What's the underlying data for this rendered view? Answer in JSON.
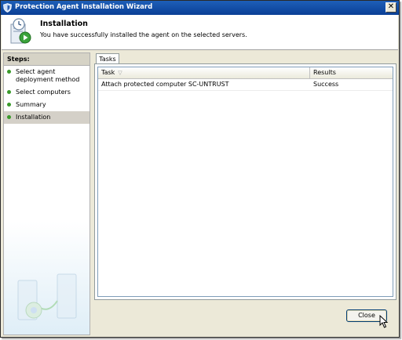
{
  "window": {
    "title": "Protection Agent Installation Wizard",
    "close_glyph": "✕"
  },
  "header": {
    "title": "Installation",
    "subtitle": "You have successfully installed the agent on the selected servers."
  },
  "steps": {
    "label": "Steps:",
    "items": [
      {
        "label": "Select agent deployment method",
        "active": false
      },
      {
        "label": "Select computers",
        "active": false
      },
      {
        "label": "Summary",
        "active": false
      },
      {
        "label": "Installation",
        "active": true
      }
    ]
  },
  "tabs": [
    {
      "label": "Tasks",
      "selected": true
    }
  ],
  "grid": {
    "columns": [
      "Task",
      "Results"
    ],
    "rows": [
      {
        "task": "Attach protected computer SC-UNTRUST",
        "result": "Success"
      }
    ]
  },
  "buttons": {
    "close_label": "Close"
  },
  "colors": {
    "titlebar": "#0a3f95",
    "step_dot": "#3a9a2a",
    "window_bg": "#ece9d8"
  },
  "icons": {
    "app": "shield-icon",
    "header": "wizard-clock-icon"
  }
}
